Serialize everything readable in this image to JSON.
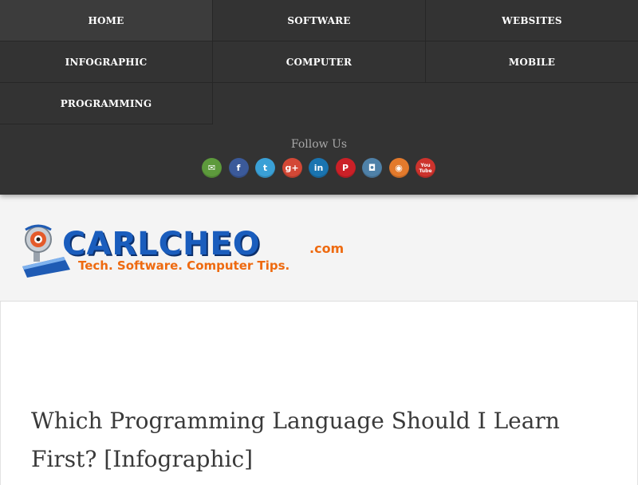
{
  "nav": {
    "items": [
      {
        "label": "HOME"
      },
      {
        "label": "SOFTWARE"
      },
      {
        "label": "WEBSITES"
      },
      {
        "label": "INFOGRAPHIC"
      },
      {
        "label": "COMPUTER"
      },
      {
        "label": "MOBILE"
      },
      {
        "label": "PROGRAMMING"
      }
    ]
  },
  "follow": {
    "label": "Follow Us",
    "icons": [
      {
        "name": "email-icon",
        "glyph": "✉",
        "color": "#5d9a3c"
      },
      {
        "name": "facebook-icon",
        "glyph": "f",
        "color": "#3b5a9a"
      },
      {
        "name": "twitter-icon",
        "glyph": "t",
        "color": "#3aa0d6"
      },
      {
        "name": "google-plus-icon",
        "glyph": "g+",
        "color": "#d34836"
      },
      {
        "name": "linkedin-icon",
        "glyph": "in",
        "color": "#1a74b0"
      },
      {
        "name": "pinterest-icon",
        "glyph": "P",
        "color": "#cb2027"
      },
      {
        "name": "instagram-icon",
        "glyph": "◘",
        "color": "#4f81a8"
      },
      {
        "name": "rss-icon",
        "glyph": "◉",
        "color": "#e37a2c"
      },
      {
        "name": "youtube-icon",
        "glyph": "You Tube",
        "color": "#cd332d"
      }
    ]
  },
  "header": {
    "logo": {
      "name": "CARLCHEO",
      "dotcom": ".com",
      "tagline": "Tech. Software. Computer Tips."
    }
  },
  "post": {
    "title": "Which Programming Language Should I Learn First? [Infographic]"
  },
  "colors": {
    "topbar": "#333333",
    "logo_blue": "#1a5dbd",
    "logo_orange": "#ee6a10"
  }
}
